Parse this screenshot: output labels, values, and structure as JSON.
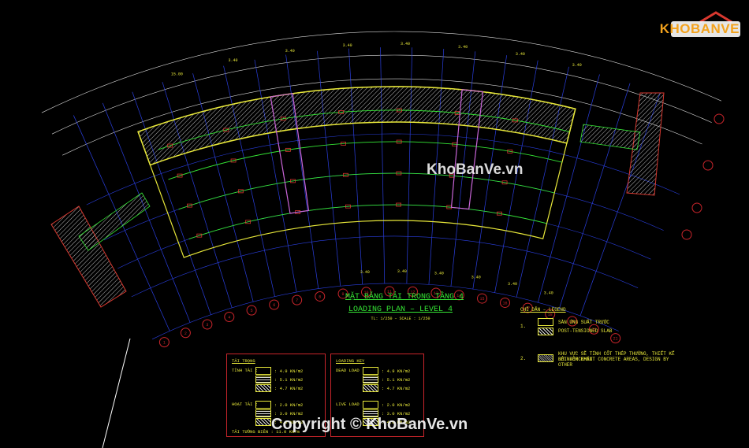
{
  "drawing": {
    "title_vn": "MẶT BẰNG TẢI TRỌNG TẦNG 4",
    "title_en": "LOADING PLAN – LEVEL 4",
    "scale_note": "TL: 1/250 – SCALE : 1/250",
    "colors": {
      "background": "#000000",
      "grid": "#2a3fe0",
      "dimension": "#d9d9d9",
      "slab": "#e8e83a",
      "beam": "#35e635",
      "column": "#d8382f",
      "core": "#c965d8",
      "bubble": "#c9252b"
    }
  },
  "dimensions": {
    "top": [
      "15.00",
      "3.40",
      "3.40",
      "3.40",
      "3.40",
      "3.40",
      "3.40",
      "3.40"
    ],
    "bottom": [
      "3.40",
      "3.40",
      "3.40",
      "3.40",
      "3.40",
      "3.40"
    ]
  },
  "grid_bubbles": {
    "bottom": [
      "1",
      "2",
      "3",
      "4",
      "5",
      "6",
      "7",
      "8",
      "9",
      "10",
      "11",
      "12",
      "13",
      "14",
      "15",
      "16",
      "17",
      "18",
      "19",
      "20",
      "21"
    ]
  },
  "legend": {
    "title": "CHỈ DẪN – LEGEND",
    "items": [
      {
        "num": "1.",
        "vn": "SÀN ỨNG SUẤT TRƯỚC",
        "en": "POST-TENSIONED SLAB"
      },
      {
        "num": "2.",
        "vn": "KHU VỰC SẼ TÍNH CỐT THÉP THƯỜNG, THIẾT KẾ BỞI BÊN KHÁC",
        "en": "REINFORCEMENT CONCRETE AREAS, DESIGN BY OTHER"
      }
    ]
  },
  "table_left": {
    "title": "TẢI TRỌNG",
    "dead_label": "TĨNH TẢI :",
    "dead_values": [
      ": 4.9 KN/m2",
      ": 5.1 KN/m2",
      ": 4.7 KN/m2"
    ],
    "live_label": "HOẠT TẢI :",
    "live_values": [
      ": 2.0 KN/m2",
      ": 3.0 KN/m2",
      ": 4.0 KN/m2"
    ],
    "footer": "TẢI TƯỜNG BIÊN : 11.0 KN/m"
  },
  "table_right": {
    "title": "LOADING KEY",
    "dead_label": "DEAD LOAD :",
    "dead_values": [
      ": 4.9 KN/m2",
      ": 5.1 KN/m2",
      ": 4.7 KN/m2"
    ],
    "live_label": "LIVE LOAD :",
    "live_values": [
      ": 2.0 KN/m2",
      ": 3.0 KN/m2",
      ": 4.0 KN/m2"
    ]
  },
  "brand": {
    "logo": "KHOBANVE",
    "watermark": "KhoBanVe.vn",
    "copyright": "Copyright © KhoBanVe.vn"
  }
}
